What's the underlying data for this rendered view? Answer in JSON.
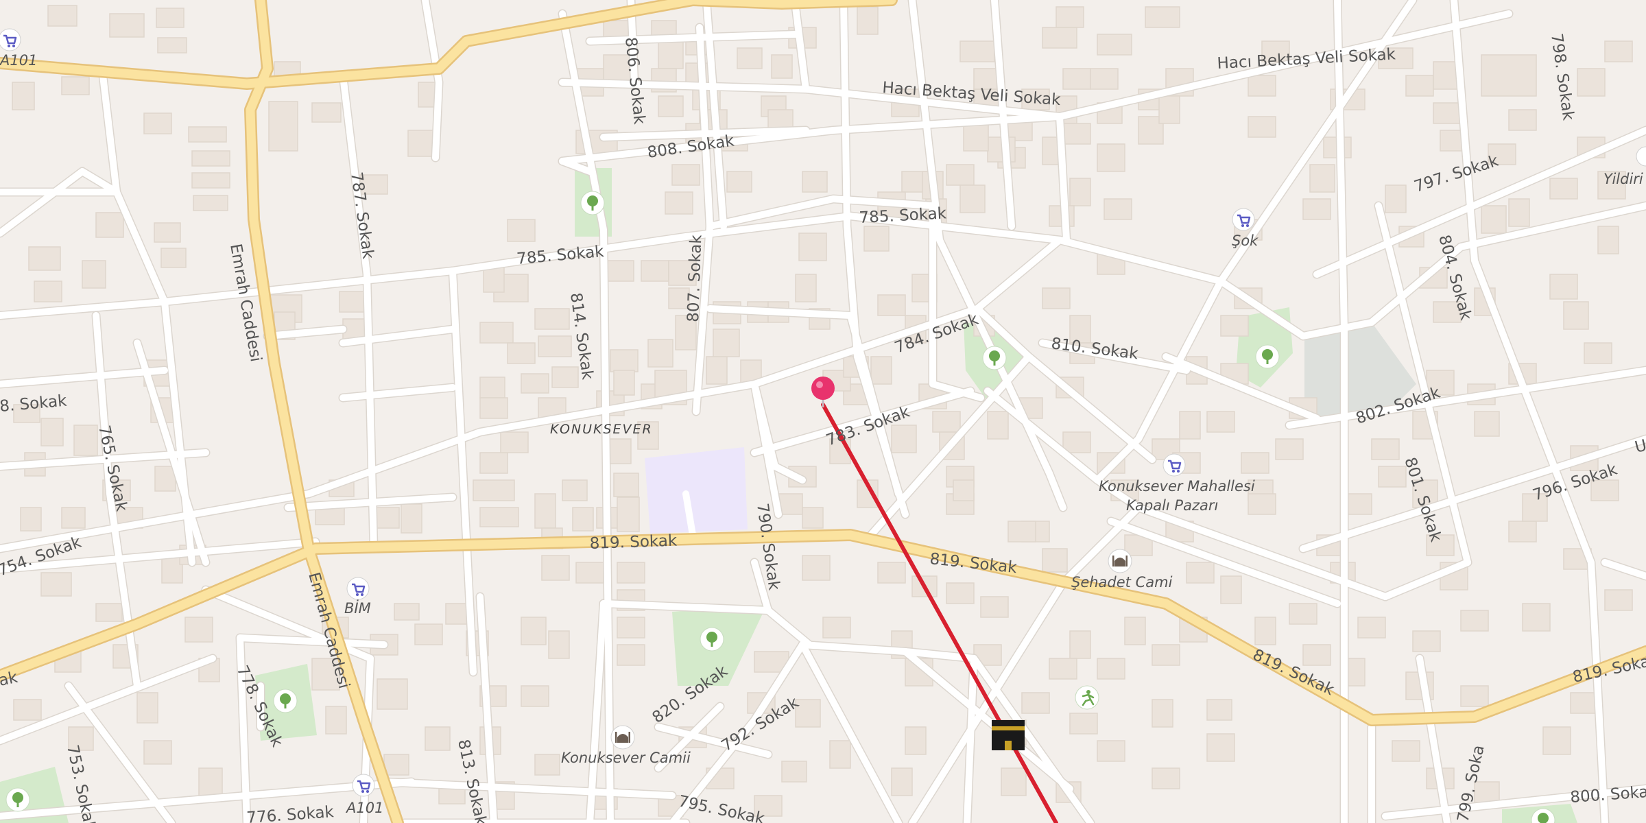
{
  "map": {
    "area_name": "KONUKSEVER",
    "streets": {
      "hacibektas_1": "Hacı Bektaş Veli Sokak",
      "hacibektas_2": "Hacı Bektaş Veli Sokak",
      "s806": "806. Sokak",
      "s808": "808. Sokak",
      "s798": "798. Sokak",
      "s787": "787. Sokak",
      "s797": "797. Sokak",
      "s785a": "785. Sokak",
      "s785b": "785. Sokak",
      "s807": "807. Sokak",
      "s804": "804. Sokak",
      "s814": "814. Sokak",
      "s784": "784. Sokak",
      "s810": "810. Sokak",
      "emrah1": "Emrah Caddesi",
      "emrah2": "Emrah Caddesi",
      "s8left": "8. Sokak",
      "s783": "783. Sokak",
      "s802": "802. Sokak",
      "s765": "765. Sokak",
      "s801": "801. Sokak",
      "s796": "796. Sokak",
      "s819a": "819. Sokak",
      "s819b": "819. Sokak",
      "s819c": "819. Sokak",
      "s819d": "819. Sokak",
      "s790": "790. Sokak",
      "s754": "754. Sokak",
      "s778": "778. Sokak",
      "s820": "820. Sokak",
      "s792": "792. Sokak",
      "s753": "753. Sokak",
      "s813": "813. Sokak",
      "s776": "776. Sokak",
      "s795": "795. Sokak",
      "s800": "800. Soka",
      "s799": "799. Soka",
      "s_ak": "ak",
      "s_u": "U"
    },
    "pois": {
      "a101_top": "A101",
      "sok": "Şok",
      "yildirim": "Yildiri",
      "bim": "BİM",
      "kapali_pazar_1": "Konuksever Mahallesi",
      "kapali_pazar_2": "Kapalı Pazarı",
      "sehadet": "Şehadet Cami",
      "konuksever_camii": "Konuksever Camii",
      "a101_bottom": "A101"
    },
    "icons": {
      "shop": "shopping-cart-icon",
      "park": "tree-icon",
      "mosque": "mosque-icon",
      "sport": "running-person-icon",
      "kaaba": "kaaba-icon",
      "marker": "location-pin-icon"
    },
    "colors": {
      "background": "#f3efeb",
      "major_road": "#fbe3a0",
      "route_line": "#d8202f",
      "marker": "#e8336d",
      "park": "#cde8c2",
      "poi_icon": "#5b5bc4"
    }
  }
}
